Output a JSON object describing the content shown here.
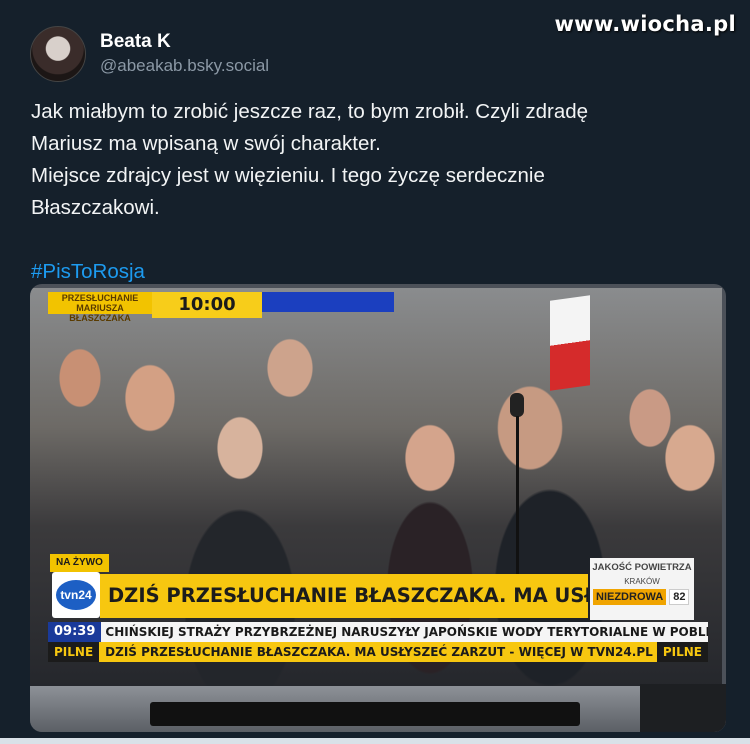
{
  "watermark": "www.wiocha.pl",
  "post": {
    "display_name": "Beata K",
    "handle": "@abeakab.bsky.social",
    "lines": [
      "Jak miałbym to zrobić jeszcze raz, to bym zrobił. Czyli zdradę",
      "Mariusz ma wpisaną w swój charakter.",
      "Miejsce zdrajcy jest w więzieniu. I tego życzę serdecznie",
      "Błaszczakowi."
    ],
    "hashtag": "#PisToRosja"
  },
  "tv": {
    "top_label_line1": "PRZESŁUCHANIE",
    "top_label_line2": "MARIUSZA BŁASZCZAKA",
    "top_time": "10:00",
    "live_label": "NA ŻYWO",
    "logo_text": "tvn24",
    "headline": "DZIŚ PRZESŁUCHANIE BŁASZCZAKA. MA USŁYSZEĆ ZARZUT",
    "air_quality": {
      "title": "JAKOŚĆ POWIETRZA",
      "city": "KRAKÓW",
      "status": "NIEZDROWA",
      "value": "82"
    },
    "ticker_time": "09:39",
    "ticker_text": "CHIŃSKIEJ STRAŻY PRZYBRZEŻNEJ NARUSZYŁY JAPOŃSKIE WODY TERYTORIALNE W POBLIŻU SP",
    "pilne_label": "PILNE",
    "pilne_text": "DZIŚ PRZESŁUCHANIE BŁASZCZAKA. MA USŁYSZEĆ ZARZUT - WIĘCEJ W TVN24.PL"
  }
}
